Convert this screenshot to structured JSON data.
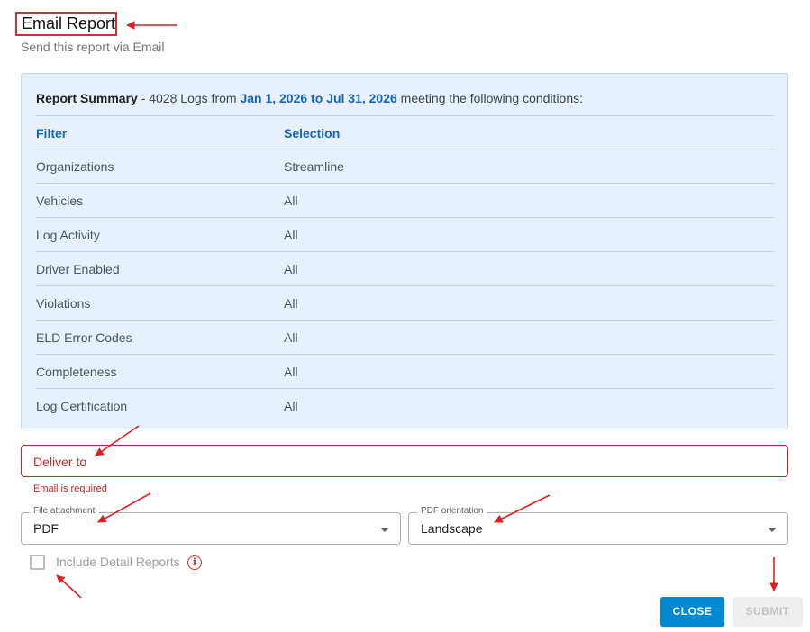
{
  "dialog": {
    "title": "Email Report",
    "subtitle": "Send this report via Email"
  },
  "summary": {
    "label": "Report Summary",
    "separator": " - ",
    "count_text": "4028 Logs from ",
    "date_range": "Jan 1, 2026 to Jul 31, 2026",
    "suffix": " meeting the following conditions:",
    "columns": [
      "Filter",
      "Selection"
    ],
    "rows": [
      {
        "filter": "Organizations",
        "selection": "Streamline"
      },
      {
        "filter": "Vehicles",
        "selection": "All"
      },
      {
        "filter": "Log Activity",
        "selection": "All"
      },
      {
        "filter": "Driver Enabled",
        "selection": "All"
      },
      {
        "filter": "Violations",
        "selection": "All"
      },
      {
        "filter": "ELD Error Codes",
        "selection": "All"
      },
      {
        "filter": "Completeness",
        "selection": "All"
      },
      {
        "filter": "Log Certification",
        "selection": "All"
      }
    ]
  },
  "deliver_to": {
    "placeholder": "Deliver to",
    "error": "Email is required"
  },
  "file_attachment": {
    "label": "File attachment",
    "value": "PDF"
  },
  "pdf_orientation": {
    "label": "PDF orientation",
    "value": "Landscape"
  },
  "include_detail": {
    "label": "Include Detail Reports",
    "checked": false,
    "info_glyph": "i"
  },
  "buttons": {
    "close": "CLOSE",
    "submit": "SUBMIT"
  },
  "colors": {
    "accent": "#0288d1",
    "error": "#c62828",
    "summary_bg": "#e8f0fc",
    "link": "#1565c0",
    "annotation": "#e02020"
  }
}
